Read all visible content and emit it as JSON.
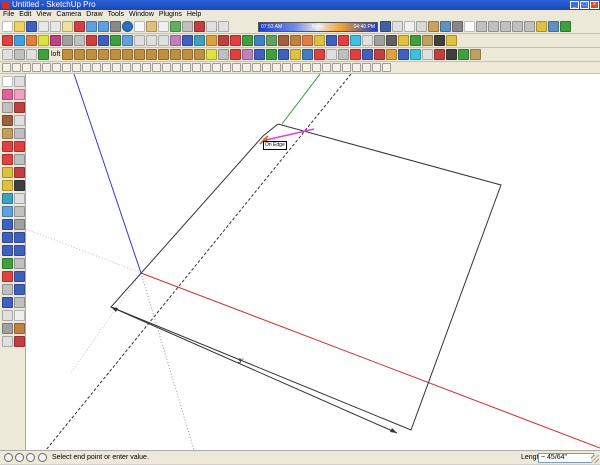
{
  "window": {
    "title": "Untitled - SketchUp Pro",
    "controls": [
      "_",
      "□",
      "×"
    ]
  },
  "menu": {
    "items": [
      "File",
      "Edit",
      "View",
      "Camera",
      "Draw",
      "Tools",
      "Window",
      "Plugins",
      "Help"
    ]
  },
  "toolbar": {
    "loft_label": "loft",
    "shadow_time_start": "07:53 AM",
    "shadow_time_noon": "Noon",
    "shadow_time_end": "04:40 PM"
  },
  "viewport": {
    "inference_tooltip": "On Edge",
    "dimension_label": "3\""
  },
  "status": {
    "message": "Select end point or enter value.",
    "length_label": "Length",
    "length_value": "~ 45/64\""
  }
}
